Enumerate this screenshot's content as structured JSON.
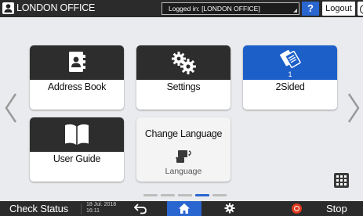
{
  "header": {
    "user_icon": "user-icon",
    "office_name": "LONDON OFFICE",
    "login_status": "Logged in: [LONDON OFFICE]",
    "help_label": "?",
    "logout_label": "Logout"
  },
  "tiles": [
    {
      "label": "Address Book",
      "icon": "address-book-icon"
    },
    {
      "label": "Settings",
      "icon": "gears-icon"
    },
    {
      "label": "2Sided",
      "icon": "duplex-copy-icon",
      "count": "1"
    },
    {
      "label": "User Guide",
      "icon": "open-book-icon"
    }
  ],
  "language_tile": {
    "title": "Change Language",
    "subtitle": "Language",
    "icon": "language-switch-icon"
  },
  "pagination": {
    "pages": 5,
    "active_page": 4
  },
  "footer": {
    "check_status": "Check Status",
    "date": "18 Jul. 2018",
    "time": "16:11",
    "stop_label": "Stop"
  },
  "colors": {
    "accent": "#2a66d0",
    "bar": "#2b2b2b",
    "background": "#e9ebee",
    "stop": "#e03a1e"
  }
}
